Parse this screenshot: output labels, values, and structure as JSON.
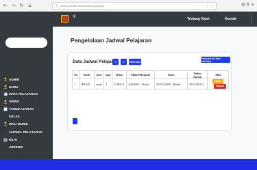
{
  "browser": {
    "url": "localhost/SIMonitor/Jadwal-pelajaran",
    "nav_icons": [
      "back-icon",
      "forward-icon",
      "reload-icon",
      "home-icon"
    ],
    "url_actions": "⋯ ☆ ☆",
    "tools": "▥ ⧉ ≡"
  },
  "topbar": {
    "links": [
      "Tentang Kami",
      "Kontak"
    ]
  },
  "sidebar": {
    "items": [
      {
        "label": "ADMIN",
        "icon": "person-icon",
        "sub": false
      },
      {
        "label": "GURU",
        "icon": "person-icon",
        "sub": false
      },
      {
        "label": "MATA PELAJARAN",
        "icon": "book-icon",
        "sub": false
      },
      {
        "label": "SISWA",
        "icon": "person-icon",
        "sub": false
      },
      {
        "label": "TAHUN AJARAN",
        "icon": "calendar-icon",
        "sub": false
      },
      {
        "label": "KELAS",
        "icon": "",
        "sub": true
      },
      {
        "label": "WALI MURID",
        "icon": "person-icon",
        "sub": false
      },
      {
        "label": "JADWAL PELAJARAN",
        "icon": "",
        "sub": true
      },
      {
        "label": "NILAI",
        "icon": "list-icon",
        "sub": false
      },
      {
        "label": "ABSENSI",
        "icon": "",
        "sub": true
      }
    ]
  },
  "main": {
    "title": "Pengelolaan Jadwal Pelajaran",
    "card_title": "Data Jadwal Pelajaran",
    "buttons": {
      "add": "+",
      "add2": "+",
      "refresh": "Refresh",
      "search": "Pencarian dan Sorting"
    },
    "table": {
      "headers": [
        "No",
        "Kode",
        "hari",
        "jam",
        "Kelas",
        "Mata Pelajaran",
        "Guru",
        "Tahun Ajaran",
        "Aksi"
      ],
      "rows": [
        {
          "no": "1",
          "kode": "JPA345",
          "hari": "senin",
          "jam": "2",
          "kelas": "X-IPA-A",
          "mapel": "A2PA001 - Fisika",
          "guru": "2015143002 - Rendy",
          "tahun": "2015/2016-1",
          "edit": "Ubah",
          "delete": "Hapus"
        }
      ]
    }
  },
  "colors": {
    "sidebar_bg": "#343a40",
    "accent_blue": "#1e3cff",
    "warning": "#f5a623",
    "danger": "#e8213a",
    "bottom_strip": "#1e2de6"
  }
}
